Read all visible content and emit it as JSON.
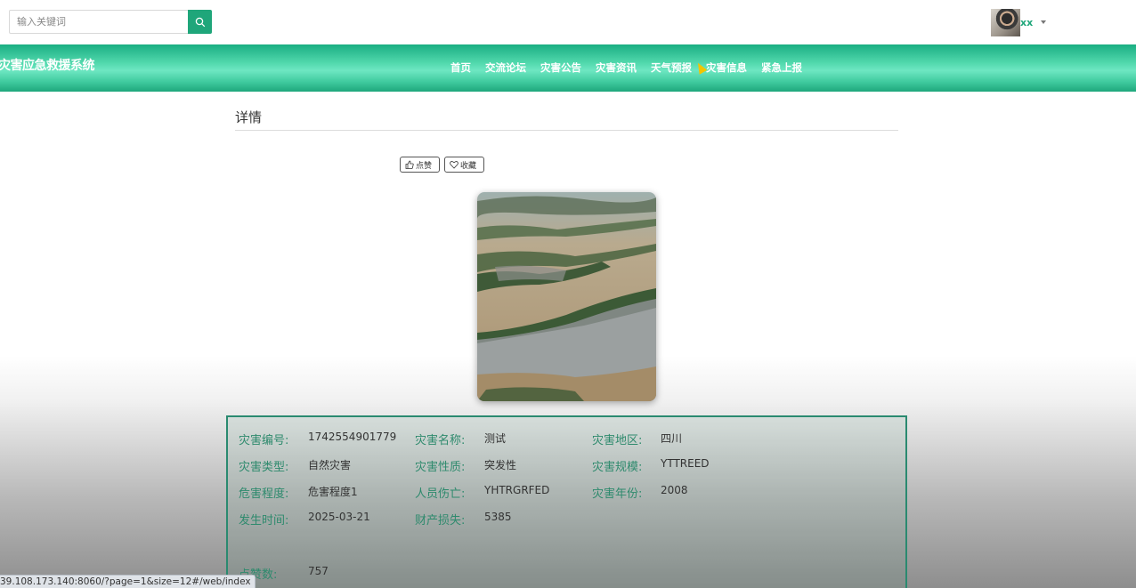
{
  "search": {
    "placeholder": "输入关键词"
  },
  "user": {
    "name": "xx"
  },
  "site": {
    "title": "灾害应急救援系统"
  },
  "nav": {
    "items": [
      "首页",
      "交流论坛",
      "灾害公告",
      "灾害资讯",
      "天气预报",
      "灾害信息",
      "紧急上报"
    ]
  },
  "detail": {
    "heading": "详情",
    "like_label": "点赞",
    "favorite_label": "收藏"
  },
  "info": {
    "code_label": "灾害编号:",
    "code_value": "1742554901779",
    "name_label": "灾害名称:",
    "name_value": "测试",
    "region_label": "灾害地区:",
    "region_value": "四川",
    "type_label": "灾害类型:",
    "type_value": "自然灾害",
    "nature_label": "灾害性质:",
    "nature_value": "突发性",
    "scale_label": "灾害规模:",
    "scale_value": "YTTREED",
    "degree_label": "危害程度:",
    "degree_value": "危害程度1",
    "casualty_label": "人员伤亡:",
    "casualty_value": "YHTRGRFED",
    "year_label": "灾害年份:",
    "year_value": "2008",
    "time_label": "发生时间:",
    "time_value": "2025-03-21",
    "loss_label": "财产损失:",
    "loss_value": "5385",
    "likes_label": "点赞数:",
    "likes_value": "757"
  },
  "status_bar": {
    "url": "39.108.173.140:8060/?page=1&size=12#/web/index"
  },
  "colors": {
    "accent": "#1fa67a",
    "label": "#2e8a6d"
  }
}
